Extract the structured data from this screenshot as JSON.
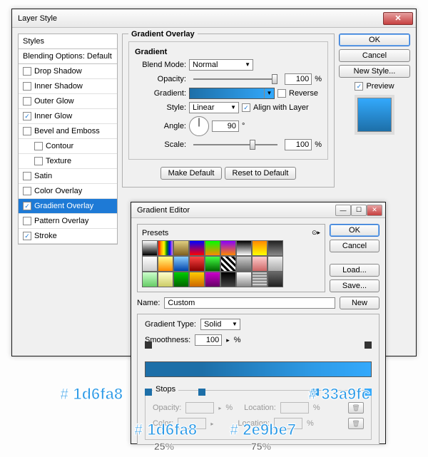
{
  "layerStyle": {
    "title": "Layer Style",
    "stylesHeader": "Styles",
    "blendingOptions": "Blending Options: Default",
    "items": [
      {
        "label": "Drop Shadow",
        "checked": false
      },
      {
        "label": "Inner Shadow",
        "checked": false
      },
      {
        "label": "Outer Glow",
        "checked": false
      },
      {
        "label": "Inner Glow",
        "checked": true
      },
      {
        "label": "Bevel and Emboss",
        "checked": false
      },
      {
        "label": "Contour",
        "checked": false,
        "indent": true
      },
      {
        "label": "Texture",
        "checked": false,
        "indent": true
      },
      {
        "label": "Satin",
        "checked": false
      },
      {
        "label": "Color Overlay",
        "checked": false
      },
      {
        "label": "Gradient Overlay",
        "checked": true,
        "selected": true
      },
      {
        "label": "Pattern Overlay",
        "checked": false
      },
      {
        "label": "Stroke",
        "checked": true
      }
    ],
    "section": {
      "title": "Gradient Overlay",
      "groupTitle": "Gradient",
      "blendModeLabel": "Blend Mode:",
      "blendMode": "Normal",
      "opacityLabel": "Opacity:",
      "opacity": "100",
      "gradientLabel": "Gradient:",
      "reverseLabel": "Reverse",
      "styleLabel": "Style:",
      "style": "Linear",
      "alignLabel": "Align with Layer",
      "angleLabel": "Angle:",
      "angle": "90",
      "scaleLabel": "Scale:",
      "scale": "100",
      "pct": "%",
      "deg": "°",
      "makeDefault": "Make Default",
      "resetDefault": "Reset to Default"
    },
    "buttons": {
      "ok": "OK",
      "cancel": "Cancel",
      "newStyle": "New Style...",
      "preview": "Preview"
    }
  },
  "gradientEditor": {
    "title": "Gradient Editor",
    "presetsLabel": "Presets",
    "ok": "OK",
    "cancel": "Cancel",
    "load": "Load...",
    "save": "Save...",
    "nameLabel": "Name:",
    "name": "Custom",
    "new": "New",
    "typeLabel": "Gradient Type:",
    "type": "Solid",
    "smoothLabel": "Smoothness:",
    "smooth": "100",
    "pct": "%",
    "stopsLabel": "Stops",
    "opacityLabel": "Opacity:",
    "locationLabel": "Location:",
    "colorLabel": "Color:"
  },
  "callouts": {
    "c1": "# 1d6fa8",
    "c2": "# 33a9fc",
    "c3": "# 1d6fa8",
    "c4": "# 2e9be7",
    "p1": "25%",
    "p2": "75%"
  },
  "presetColors": [
    "linear-gradient(#fff,#000)",
    "linear-gradient(90deg,red,orange,yellow,green,blue,violet)",
    "linear-gradient(#e0d080,#806020)",
    "linear-gradient(#00f,#f00)",
    "linear-gradient(#0f0,#f80)",
    "linear-gradient(#80f,#f80)",
    "linear-gradient(#000,#fff)",
    "linear-gradient(#f80,#ff0)",
    "linear-gradient(#222,#888)",
    "linear-gradient(#fff,#ccc)",
    "linear-gradient(#ff8,#f80)",
    "linear-gradient(#8cf,#04a)",
    "linear-gradient(#f44,#800)",
    "linear-gradient(#4f4,#060)",
    "repeating-linear-gradient(45deg,#000,#000 3px,#fff 3px,#fff 6px)",
    "linear-gradient(#ccc,#666)",
    "linear-gradient(#fcc,#c66)",
    "linear-gradient(#eee,#aaa)",
    "linear-gradient(#cfc,#6c6)",
    "linear-gradient(#ffc,#cc6)",
    "linear-gradient(#0c0,#060)",
    "linear-gradient(#fc0,#c60)",
    "linear-gradient(#c0c,#606)",
    "linear-gradient(#000,#444)",
    "linear-gradient(#fff,#888)",
    "repeating-linear-gradient(0deg,#888,#888 2px,#ccc 2px,#ccc 4px)",
    "linear-gradient(#666,#222)"
  ]
}
